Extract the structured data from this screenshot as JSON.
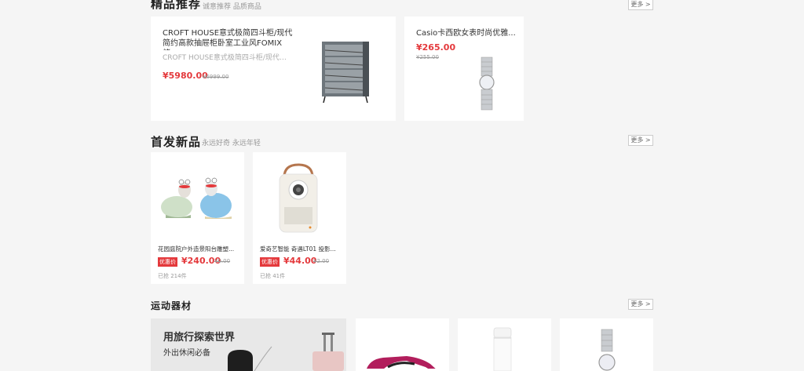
{
  "featured": {
    "title": "精品推荐",
    "subtitle": "诚意推荐 品质商品",
    "more": "更多 >",
    "items": [
      {
        "name": "CROFT HOUSE意式极简四斗柜/现代简约高款抽屉柜卧室工业风FOMIX储...",
        "desc": "CROFT HOUSE意式极简四斗柜/现代简...",
        "price": "¥5980.00",
        "old_price": "¥6999.00",
        "image": "drawer-cabinet"
      },
      {
        "name": "Casio卡西欧女表时尚优雅...",
        "price": "¥265.00",
        "old_price": "¥255.00",
        "image": "silver-watch"
      }
    ]
  },
  "new_products": {
    "title": "首发新品",
    "subtitle": "永远好奇 永远年轻",
    "more": "更多 >",
    "items": [
      {
        "name": "花园庭院户外造景阳台雕塑...",
        "tag": "优惠价",
        "price": "¥240.00",
        "old_price": "¥0.00",
        "sold": "已抢 214件",
        "image": "snail-figurines"
      },
      {
        "name": "爱奇艺智能 奇遇LT01 投影...",
        "tag": "优惠价",
        "price": "¥44.00",
        "old_price": "¥2.00",
        "sold": "已抢 41件",
        "image": "projector"
      }
    ]
  },
  "sports": {
    "title": "运动器材",
    "more": "更多 >",
    "banner": {
      "title": "用旅行探索世界",
      "subtitle": "外出休闲必备"
    },
    "items": [
      {
        "image": "sneaker"
      },
      {
        "image": "thermos-bottle"
      },
      {
        "image": "silver-watch"
      }
    ]
  },
  "colors": {
    "accent": "#e4393c",
    "page_bg": "#f5f5f5"
  }
}
